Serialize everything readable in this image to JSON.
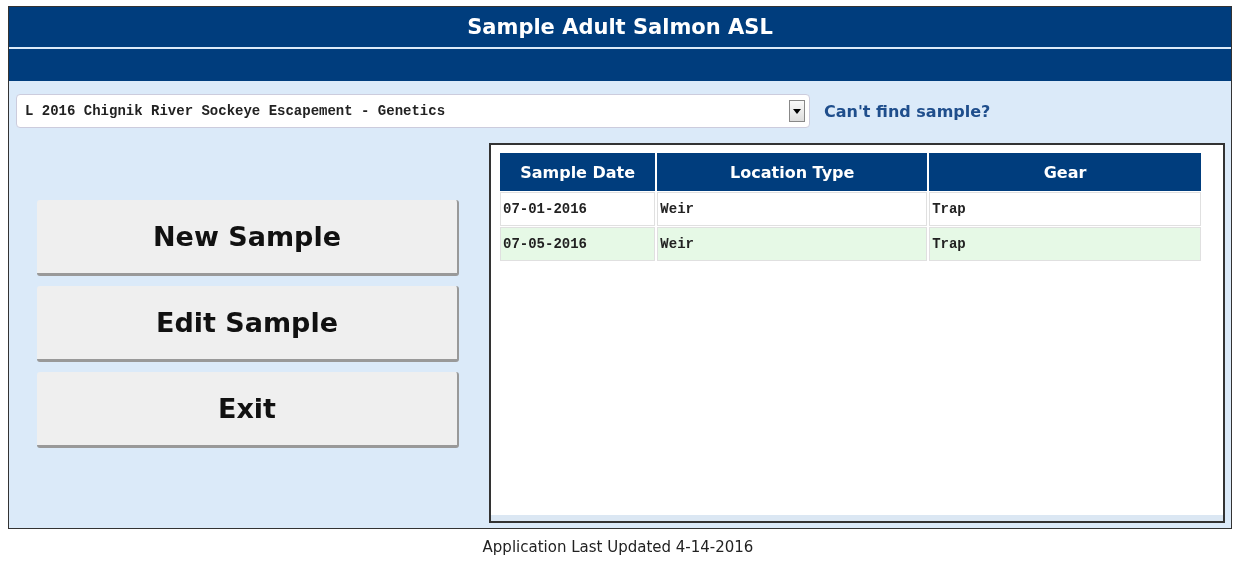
{
  "window": {
    "title": "Sample Adult Salmon ASL"
  },
  "sample_select": {
    "value": "L 2016 Chignik River Sockeye Escapement - Genetics"
  },
  "help_link": "Can't find sample?",
  "buttons": [
    "New Sample",
    "Edit Sample",
    "Exit"
  ],
  "table": {
    "columns": [
      "Sample Date",
      "Location Type",
      "Gear"
    ],
    "rows": [
      {
        "cells": [
          "07-01-2016",
          "Weir",
          "Trap"
        ],
        "selected": false
      },
      {
        "cells": [
          "07-05-2016",
          "Weir",
          "Trap"
        ],
        "selected": true
      }
    ]
  },
  "footer": "Application Last Updated 4-14-2016"
}
